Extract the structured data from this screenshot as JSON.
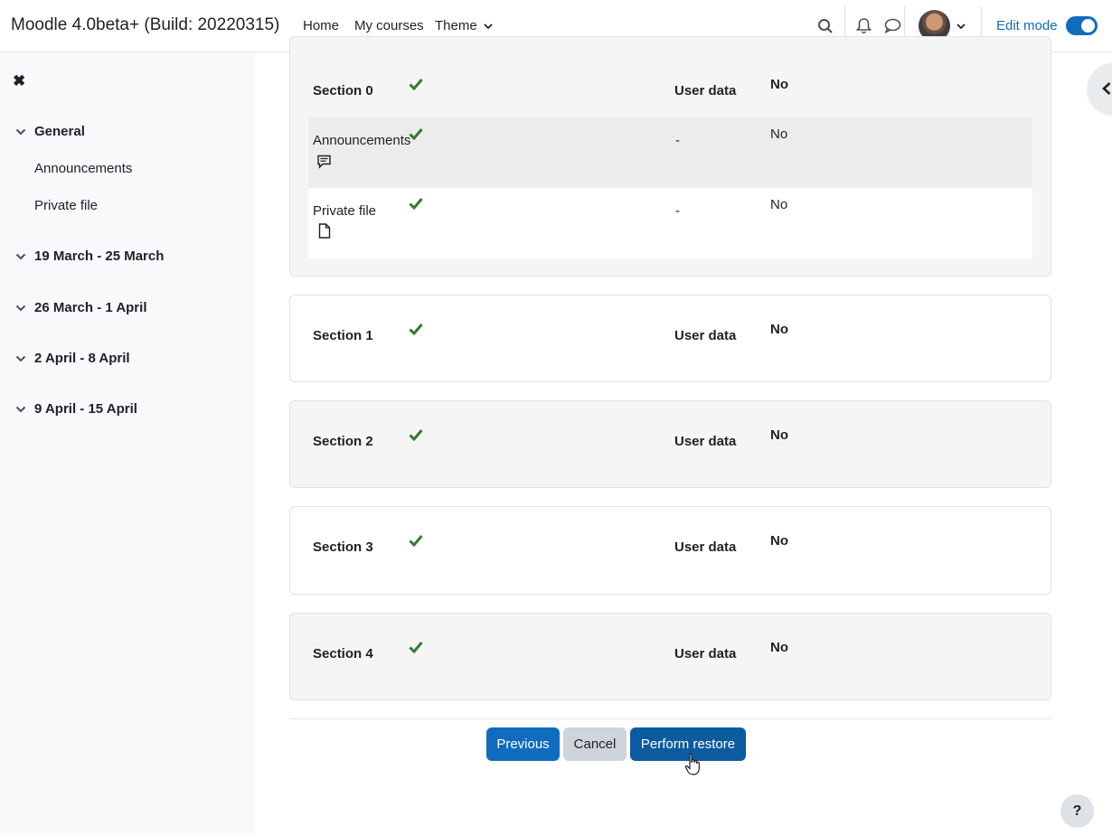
{
  "navbar": {
    "brand": "Moodle 4.0beta+ (Build: 20220315)",
    "links": [
      "Home",
      "My courses",
      "Theme"
    ],
    "active_link": "My courses",
    "edit_mode_label": "Edit mode",
    "edit_mode_on": true,
    "icons": [
      "search-icon",
      "bell-icon",
      "chat-icon",
      "avatar",
      "chevron-down-icon"
    ]
  },
  "drawer": {
    "close_glyph": "✖",
    "sections": [
      {
        "title": "General",
        "items": [
          "Announcements",
          "Private file"
        ]
      },
      {
        "title": "19 March - 25 March",
        "items": []
      },
      {
        "title": "26 March - 1 April",
        "items": []
      },
      {
        "title": "2 April - 8 April",
        "items": []
      },
      {
        "title": "9 April - 15 April",
        "items": []
      }
    ]
  },
  "main": {
    "section0": {
      "title": "Section 0",
      "user_data_label": "User data",
      "user_data_value": "No",
      "activities": [
        {
          "name": "Announcements",
          "dash": "-",
          "value": "No",
          "icon": "forum-icon"
        },
        {
          "name": "Private file",
          "dash": "-",
          "value": "No",
          "icon": "file-icon"
        }
      ]
    },
    "sections": [
      {
        "title": "Section 1",
        "user_data_label": "User data",
        "user_data_value": "No"
      },
      {
        "title": "Section 2",
        "user_data_label": "User data",
        "user_data_value": "No"
      },
      {
        "title": "Section 3",
        "user_data_label": "User data",
        "user_data_value": "No"
      },
      {
        "title": "Section 4",
        "user_data_label": "User data",
        "user_data_value": "No"
      }
    ],
    "buttons": {
      "previous": "Previous",
      "cancel": "Cancel",
      "perform_restore": "Perform restore"
    }
  },
  "help": {
    "label": "?"
  },
  "colors": {
    "primary": "#0f6cbf",
    "check": "#357a32",
    "drawer_bg": "#f8f9fa"
  }
}
